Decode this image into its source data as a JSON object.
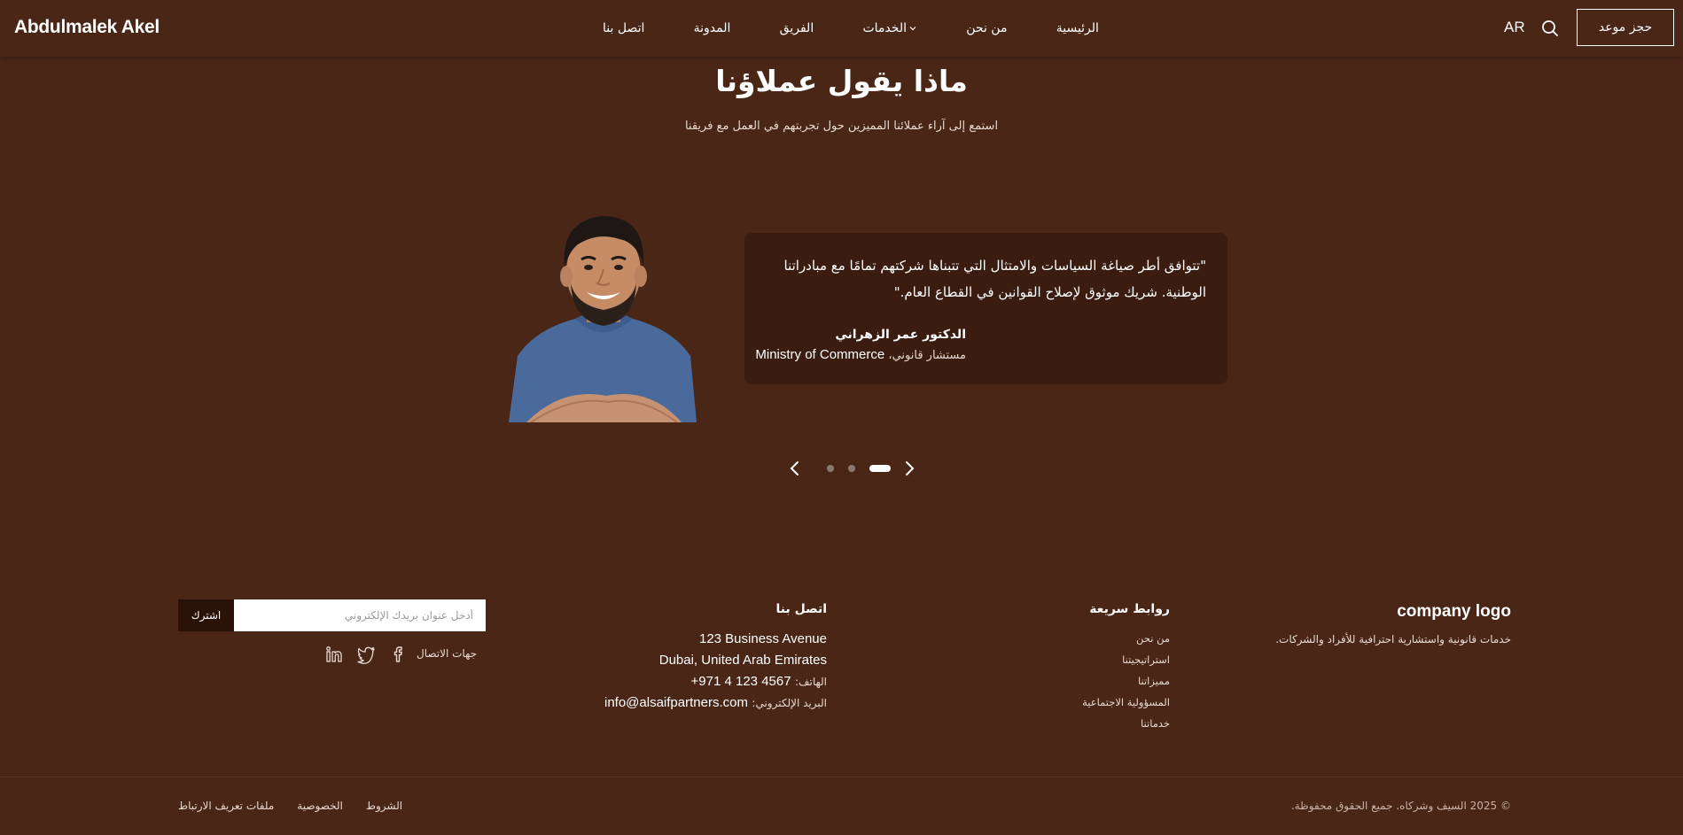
{
  "header": {
    "brand": "Abdulmalek Akel",
    "nav": [
      "الرئيسية",
      "من نحن",
      "الخدمات",
      "الفريق",
      "المدونة",
      "اتصل بنا"
    ],
    "language": "AR",
    "book_button": "حجز موعد"
  },
  "testimonials": {
    "title": "ماذا يقول عملاؤنا",
    "subtitle": "استمع إلى آراء عملائنا المميزين حول تجربتهم في العمل مع فريقنا",
    "quote": "\"تتوافق أطر صياغة السياسات والامتثال التي تتبناها شركتهم تمامًا مع مبادراتنا الوطنية. شريك موثوق لإصلاح القوانين في القطاع العام.\"",
    "author": "الدكتور عمر الزهراني",
    "role": "مستشار قانوني،",
    "organization": "Ministry of Commerce"
  },
  "footer": {
    "company": {
      "logo": "company logo",
      "description": "خدمات قانونية واستشارية احترافية للأفراد والشركات."
    },
    "quick_links": {
      "heading": "روابط سريعة",
      "items": [
        "من نحن",
        "استراتيجيتنا",
        "مميزاتنا",
        "المسؤولية الاجتماعية",
        "خدماتنا"
      ]
    },
    "contact": {
      "heading": "اتصل بنا",
      "address1": "123 Business Avenue",
      "address2": "Dubai, United Arab Emirates",
      "phone_label": "الهاتف:",
      "phone": "+971 4 123 4567",
      "email_label": "البريد الإلكتروني:",
      "email": "info@alsaifpartners.com"
    },
    "newsletter": {
      "placeholder": "أدخل عنوان بريدك الإلكتروني",
      "button": "اشترك"
    },
    "social_label": "جهات الاتصال",
    "copyright": "© 2025 السيف وشركاه. جميع الحقوق محفوظة.",
    "legal": [
      "الشروط",
      "الخصوصية",
      "ملفات تعريف الارتباط"
    ]
  }
}
